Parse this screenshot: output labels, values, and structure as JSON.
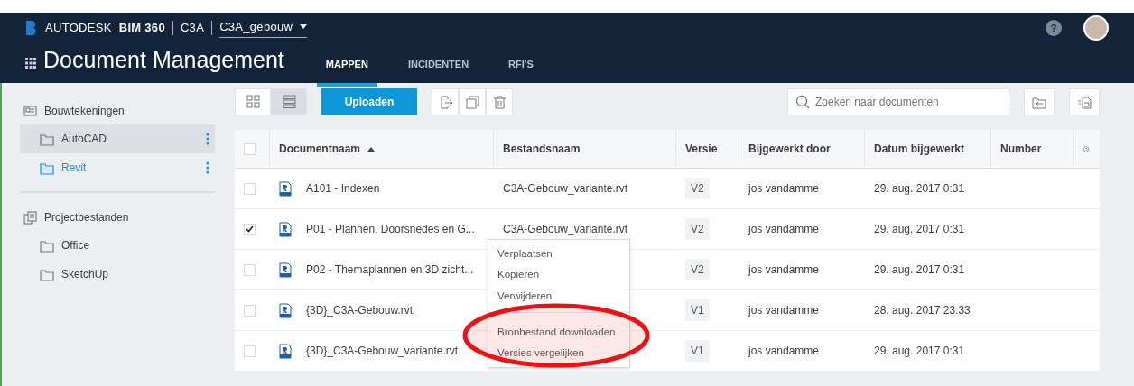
{
  "header": {
    "brand": "AUTODESK",
    "product": "BIM 360",
    "account": "C3A",
    "project": "C3A_gebouw",
    "title": "Document Management",
    "help": "?",
    "tabs": [
      {
        "label": "MAPPEN",
        "selected": true
      },
      {
        "label": "INCIDENTEN",
        "selected": false
      },
      {
        "label": "RFI'S",
        "selected": false
      }
    ]
  },
  "sidebar": {
    "sections": [
      {
        "label": "Bouwtekeningen",
        "kind": "drawings",
        "children": [
          {
            "label": "AutoCAD",
            "selected": false,
            "hovered": true
          },
          {
            "label": "Revit",
            "selected": true,
            "hovered": false
          }
        ]
      },
      {
        "label": "Projectbestanden",
        "kind": "files",
        "children": [
          {
            "label": "Office",
            "selected": false,
            "hovered": false
          },
          {
            "label": "SketchUp",
            "selected": false,
            "hovered": false
          }
        ]
      }
    ]
  },
  "toolbar": {
    "views": [
      {
        "kind": "grid",
        "selected": false
      },
      {
        "kind": "list",
        "selected": true
      }
    ],
    "upload": "Uploaden",
    "search": {
      "placeholder": "Zoeken naar documenten"
    }
  },
  "table": {
    "all_checked": false,
    "columns": [
      {
        "label": "Documentnaam",
        "sorted": true
      },
      {
        "label": "Bestandsnaam",
        "sorted": false
      },
      {
        "label": "Versie",
        "sorted": false
      },
      {
        "label": "Bijgewerkt door",
        "sorted": false
      },
      {
        "label": "Datum bijgewerkt",
        "sorted": false
      },
      {
        "label": "Number",
        "sorted": false
      }
    ],
    "rows": [
      {
        "checked": false,
        "name": "A101 - Indexen",
        "file": "C3A-Gebouw_variante.rvt",
        "version": "V2",
        "updated_by": "jos vandamme",
        "date": "29. aug. 2017 0:31"
      },
      {
        "checked": true,
        "name": "P01 - Plannen, Doorsnedes en G...",
        "file": "C3A-Gebouw_variante.rvt",
        "version": "V2",
        "updated_by": "jos vandamme",
        "date": "29. aug. 2017 0:31"
      },
      {
        "checked": false,
        "name": "P02 - Themaplannen en 3D zicht...",
        "version": "V2",
        "updated_by": "jos vandamme",
        "date": "29. aug. 2017 0:31"
      },
      {
        "checked": false,
        "name": "{3D}_C3A-Gebouw.rvt",
        "version": "V1",
        "updated_by": "jos vandamme",
        "date": "28. aug. 2017 23:33"
      },
      {
        "checked": false,
        "name": "{3D}_C3A-Gebouw_variante.rvt",
        "version": "V1",
        "updated_by": "jos vandamme",
        "date": "29. aug. 2017 0:31"
      }
    ]
  },
  "context_menu": {
    "groups": [
      [
        "Verplaatsen",
        "Kopiëren",
        "Verwijderen"
      ],
      [
        "Bronbestand downloaden",
        "Versies vergelijken"
      ]
    ]
  }
}
